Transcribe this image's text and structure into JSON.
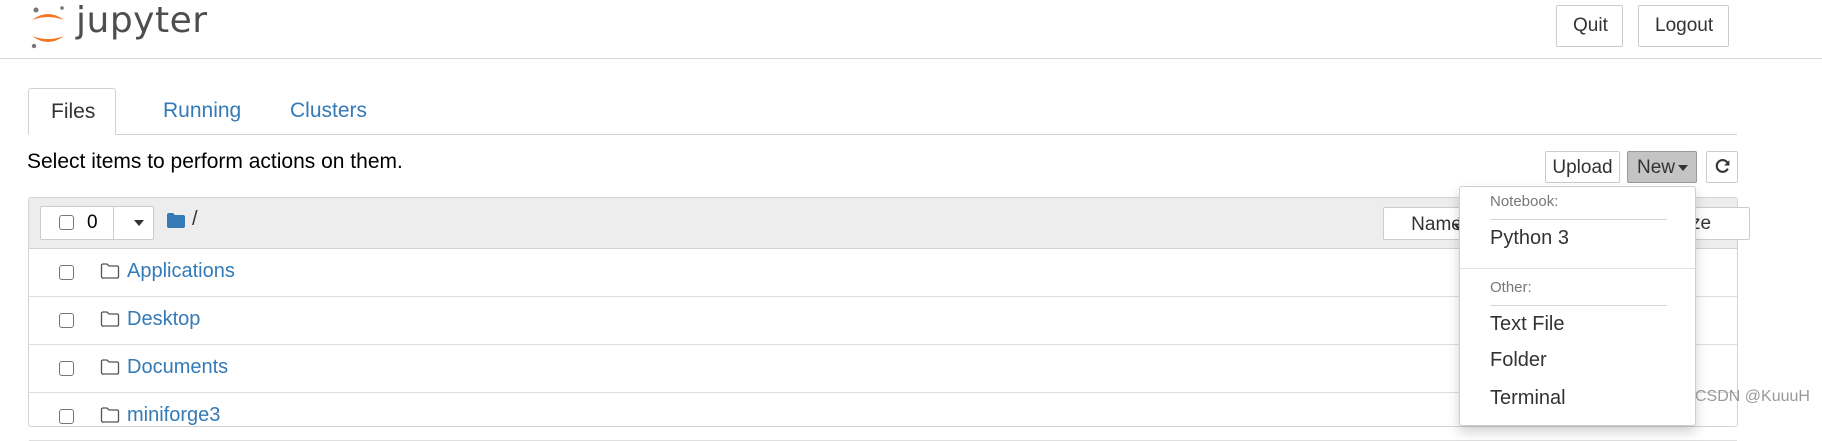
{
  "header": {
    "logo_text": "jupyter",
    "quit_label": "Quit",
    "logout_label": "Logout",
    "brand_orange": "#f37626"
  },
  "tabs": [
    {
      "label": "Files",
      "active": true
    },
    {
      "label": "Running",
      "active": false
    },
    {
      "label": "Clusters",
      "active": false
    }
  ],
  "toolbar": {
    "hint": "Select items to perform actions on them.",
    "upload_label": "Upload",
    "new_label": "New",
    "refresh_icon": "refresh-icon"
  },
  "list": {
    "selected_count": "0",
    "breadcrumb": "/",
    "sort_name_label": "Name",
    "sort_size_label": "ze",
    "items": [
      {
        "name": "Applications",
        "type": "folder"
      },
      {
        "name": "Desktop",
        "type": "folder"
      },
      {
        "name": "Documents",
        "type": "folder"
      },
      {
        "name": "miniforge3",
        "type": "folder"
      }
    ]
  },
  "new_menu": {
    "notebook_header": "Notebook:",
    "python3": "Python 3",
    "other_header": "Other:",
    "text_file": "Text File",
    "folder": "Folder",
    "terminal": "Terminal"
  },
  "watermark": "CSDN @KuuuH",
  "colors": {
    "link": "#337ab7",
    "header_bg": "#ededed",
    "active_button": "#c4c4c4"
  }
}
